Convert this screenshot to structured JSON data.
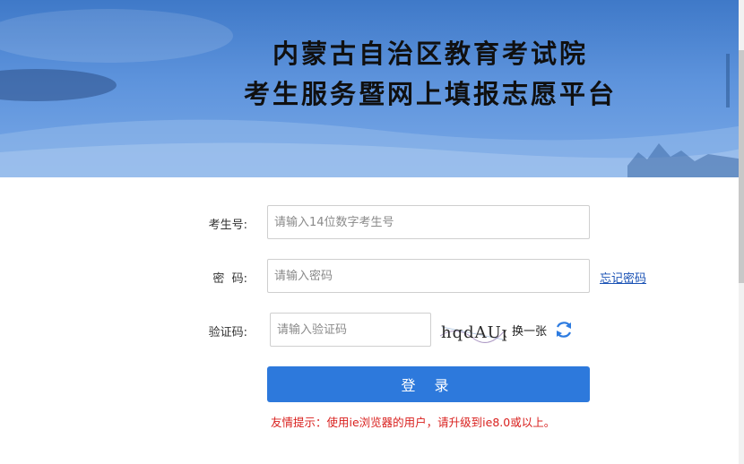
{
  "header": {
    "title_line1": "内蒙古自治区教育考试院",
    "title_line2": "考生服务暨网上填报志愿平台"
  },
  "form": {
    "exam_number": {
      "label": "考生号:",
      "placeholder": "请输入14位数字考生号",
      "value": ""
    },
    "password": {
      "label": "密  码:",
      "placeholder": "请输入密码",
      "value": ""
    },
    "forgot_password": "忘记密码",
    "captcha": {
      "label": "验证码:",
      "placeholder": "请输入验证码",
      "value": "",
      "image_text": "hqdAUp",
      "refresh_label": "换一张"
    },
    "login_button": "登 录",
    "tip": "友情提示：使用ie浏览器的用户，请升级到ie8.0或以上。"
  },
  "colors": {
    "primary": "#2d79dc",
    "banner": "#5d93dc",
    "tip": "#d9201e",
    "link": "#1a52b5"
  }
}
